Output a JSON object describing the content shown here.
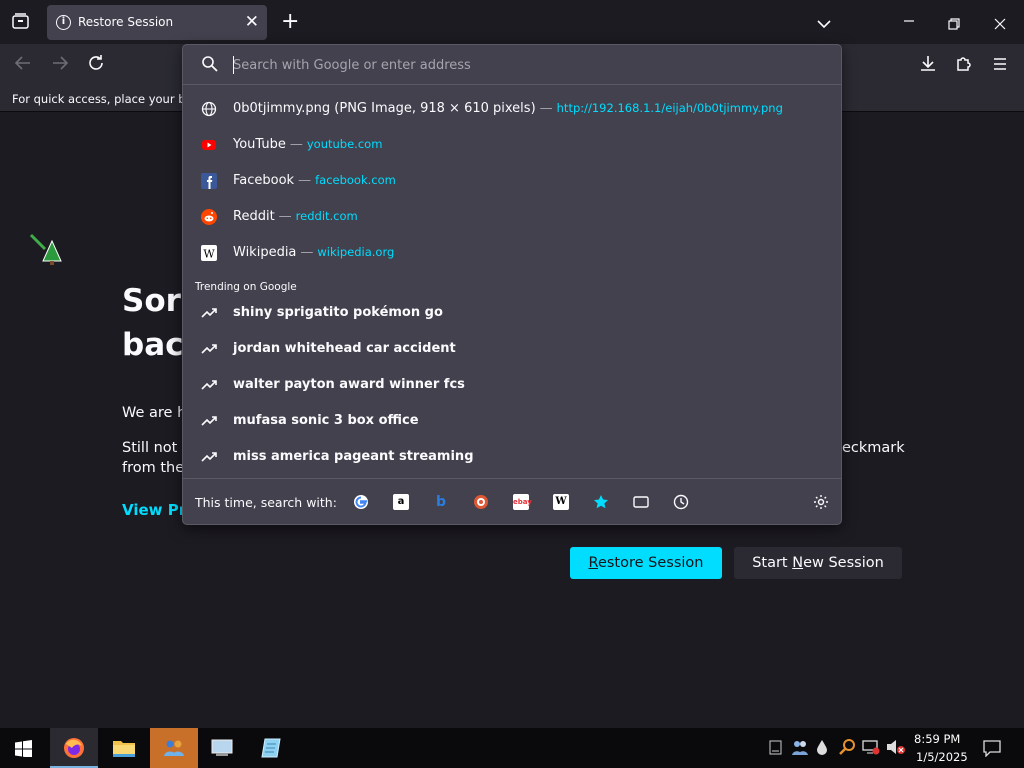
{
  "tab": {
    "title": "Restore Session"
  },
  "bookmarks_bar": {
    "text": "For quick access, place your boo"
  },
  "urlbar": {
    "placeholder": "Search with Google or enter address"
  },
  "suggestions": [
    {
      "title": "0b0tjimmy.png (PNG Image, 918 × 610 pixels)",
      "sep": "—",
      "url": "http://192.168.1.1/eijah/0b0tjimmy.png",
      "icon": "globe-icon"
    },
    {
      "title": "YouTube",
      "sep": "—",
      "url": "youtube.com",
      "icon": "youtube-icon"
    },
    {
      "title": "Facebook",
      "sep": "—",
      "url": "facebook.com",
      "icon": "facebook-icon"
    },
    {
      "title": "Reddit",
      "sep": "—",
      "url": "reddit.com",
      "icon": "reddit-icon"
    },
    {
      "title": "Wikipedia",
      "sep": "—",
      "url": "wikipedia.org",
      "icon": "wikipedia-icon"
    }
  ],
  "trending": {
    "heading": "Trending on Google",
    "items": [
      "shiny sprigatito pokémon go",
      "jordan whitehead car accident",
      "walter payton award winner fcs",
      "mufasa sonic 3 box office",
      "miss america pageant streaming"
    ]
  },
  "search_with": {
    "label": "This time, search with:",
    "engines": [
      "google-icon",
      "amazon-icon",
      "bing-icon",
      "duckduckgo-icon",
      "ebay-icon",
      "wikipedia-icon",
      "bookmarks-star-icon",
      "tabs-icon",
      "history-icon"
    ]
  },
  "page": {
    "title_line1": "Sorr",
    "title_line2": "back",
    "para1": "We are ha",
    "para2_line1": "Still not a",
    "para2_line1_tail": "eckmark",
    "para2_line2": "from the",
    "view_previous": "View Pre",
    "restore_button": "Restore Session",
    "new_session_button": "Start New Session"
  },
  "taskbar": {
    "time": "8:59 PM",
    "date": "1/5/2025"
  },
  "colors": {
    "accent": "#00ddff",
    "popup_bg": "#42414d",
    "page_bg": "#1c1b22",
    "toolbar_bg": "#2b2a33"
  }
}
